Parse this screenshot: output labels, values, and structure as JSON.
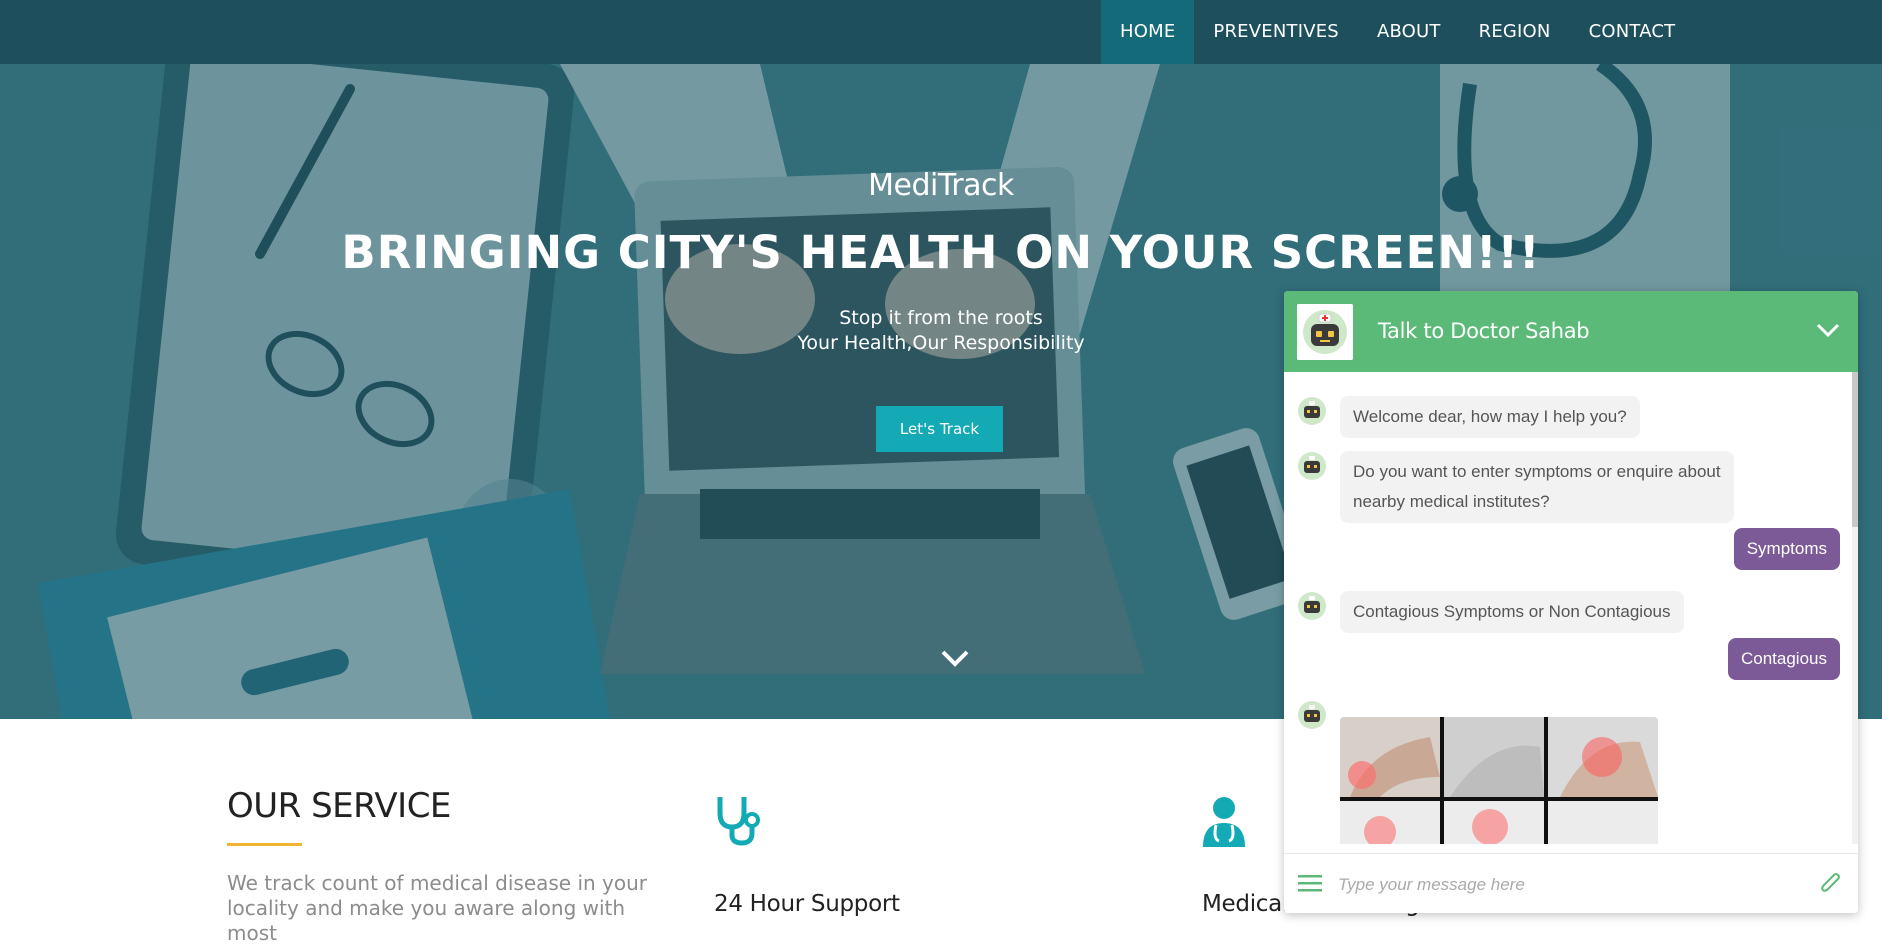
{
  "nav": {
    "items": [
      {
        "label": "HOME",
        "active": true
      },
      {
        "label": "PREVENTIVES",
        "active": false
      },
      {
        "label": "ABOUT",
        "active": false
      },
      {
        "label": "REGION",
        "active": false
      },
      {
        "label": "CONTACT",
        "active": false
      }
    ]
  },
  "hero": {
    "brand": "MediTrack",
    "headline": "BRINGING CITY'S HEALTH ON YOUR SCREEN!!!",
    "subline1": "Stop it from the roots",
    "subline2": "Your Health,Our Responsibility",
    "cta_label": "Let's Track",
    "scroll_icon": "chevron-down-icon"
  },
  "services": {
    "title": "OUR SERVICE",
    "description": "We track count of medical disease in your locality and make you aware along with most",
    "items": [
      {
        "title": "24 Hour Support",
        "icon": "stethoscope-icon"
      },
      {
        "title": "Medical Counseling",
        "icon": "doctor-icon"
      }
    ]
  },
  "chat": {
    "title": "Talk to Doctor Sahab",
    "messages": [
      {
        "from": "bot",
        "text": "Welcome dear, how may I help you?"
      },
      {
        "from": "bot",
        "text_lines": [
          "Do you want to enter symptoms or enquire about",
          "nearby medical institutes?"
        ]
      },
      {
        "from": "user",
        "text": "Symptoms"
      },
      {
        "from": "bot",
        "text": "Contagious Symptoms or Non Contagious"
      },
      {
        "from": "user",
        "text": "Contagious"
      },
      {
        "from": "bot",
        "type": "image"
      }
    ],
    "input_placeholder": "Type your message here"
  },
  "colors": {
    "nav_bg": "#1d4f5c",
    "nav_active": "#146a78",
    "cta": "#13aab5",
    "chat_header": "#5cba78",
    "user_bubble": "#7b5a97",
    "accent_rule": "#f2b533",
    "teal_icon": "#13aab5"
  }
}
